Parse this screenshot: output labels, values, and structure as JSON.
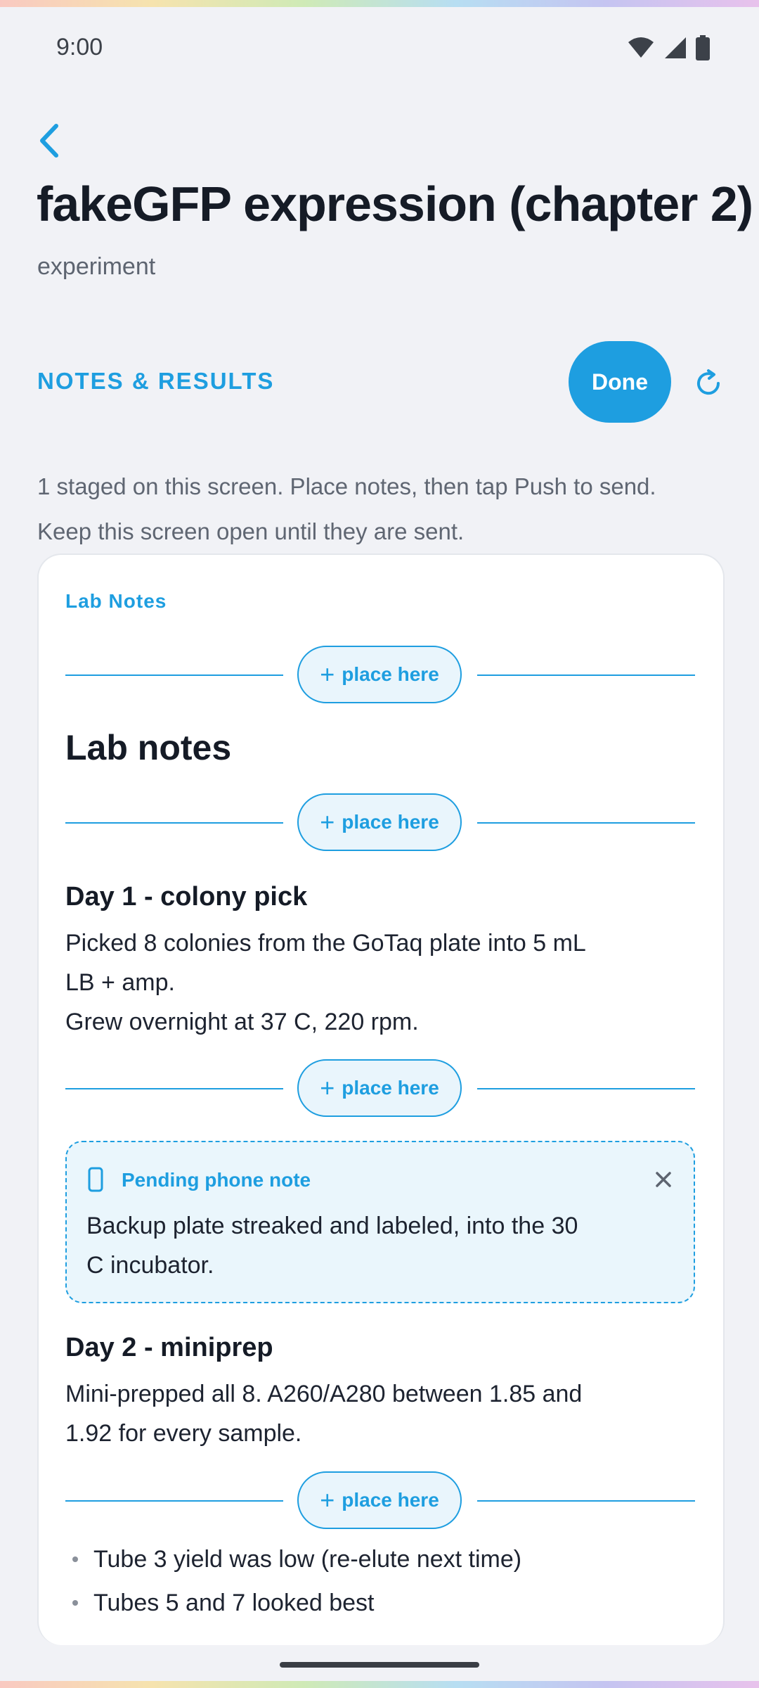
{
  "status_bar": {
    "time": "9:00",
    "icons": [
      "wifi-icon",
      "signal-icon",
      "battery-icon"
    ]
  },
  "header": {
    "back_icon": "chevron-left-icon",
    "title": "fakeGFP expression (chapter 2)",
    "subtitle": "experiment"
  },
  "section": {
    "label": "NOTES & RESULTS",
    "done_label": "Done",
    "refresh_icon": "refresh-icon"
  },
  "info": {
    "line1": "1 staged on this screen. Place notes, then tap Push to send.",
    "line2": "Keep this screen open until they are sent."
  },
  "card": {
    "label": "Lab Notes",
    "place_label": "place here",
    "heading": "Lab notes",
    "day1": {
      "title": "Day 1 - colony pick",
      "lines": [
        "Picked 8 colonies from the GoTaq plate into 5 mL",
        "LB + amp.",
        "Grew overnight at 37 C, 220 rpm."
      ]
    },
    "pending": {
      "label": "Pending phone note",
      "icon": "phone-icon",
      "close_icon": "close-icon",
      "lines": [
        "Backup plate streaked and labeled, into the 30",
        "C incubator."
      ]
    },
    "day2": {
      "title": "Day 2 - miniprep",
      "lines": [
        "Mini-prepped all 8. A260/A280 between 1.85 and",
        "1.92 for every sample."
      ]
    },
    "bullets": [
      "Tube 3 yield was low (re-elute next time)",
      "Tubes 5 and 7 looked best"
    ]
  },
  "colors": {
    "accent": "#1e9ee0",
    "background": "#f1f2f6",
    "pending_bg": "#eaf6fc"
  }
}
